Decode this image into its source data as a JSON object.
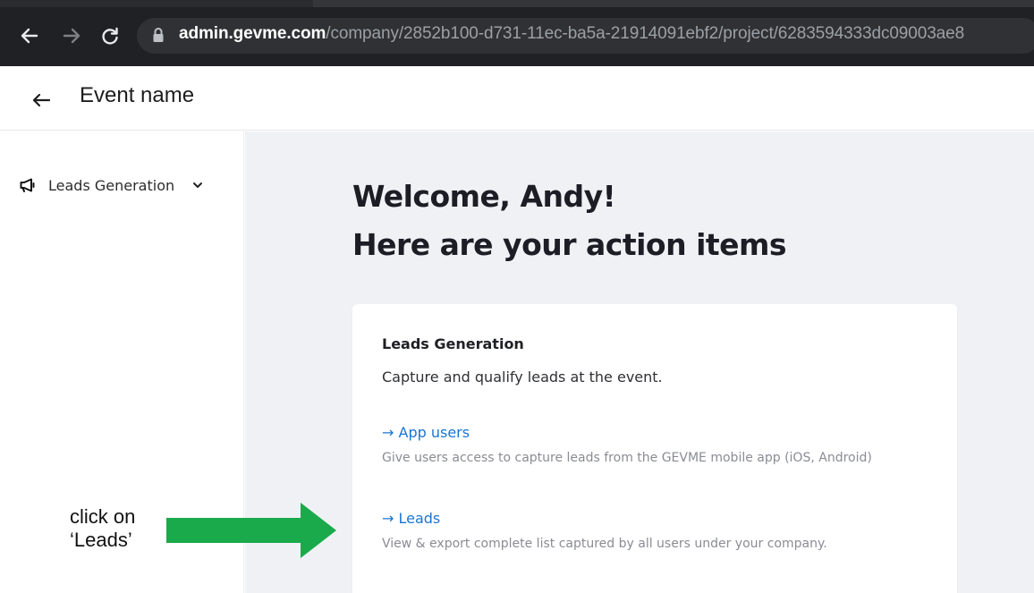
{
  "browser": {
    "url_host": "admin.gevme.com",
    "url_path": "/company/2852b100-d731-11ec-ba5a-21914091ebf2/project/6283594333dc09003ae8"
  },
  "header": {
    "title": "Event name"
  },
  "sidebar": {
    "items": [
      {
        "label": "Leads Generation",
        "icon": "megaphone-icon"
      }
    ]
  },
  "main": {
    "welcome_line1": "Welcome, Andy!",
    "welcome_line2": "Here are your action items",
    "card": {
      "title": "Leads Generation",
      "subtitle": "Capture and qualify leads at the event.",
      "links": [
        {
          "label": "→ App users",
          "description": "Give users access to capture leads from the GEVME mobile app (iOS, Android)"
        },
        {
          "label": "→ Leads",
          "description": "View & export complete list captured by all users under your company."
        }
      ]
    }
  },
  "annotation": {
    "line1": "click on",
    "line2": "‘Leads’",
    "arrow_color": "#1aaa4b"
  },
  "colors": {
    "link": "#1976d2",
    "main_bg": "#f0f1f5",
    "browser_bg": "#202124"
  }
}
